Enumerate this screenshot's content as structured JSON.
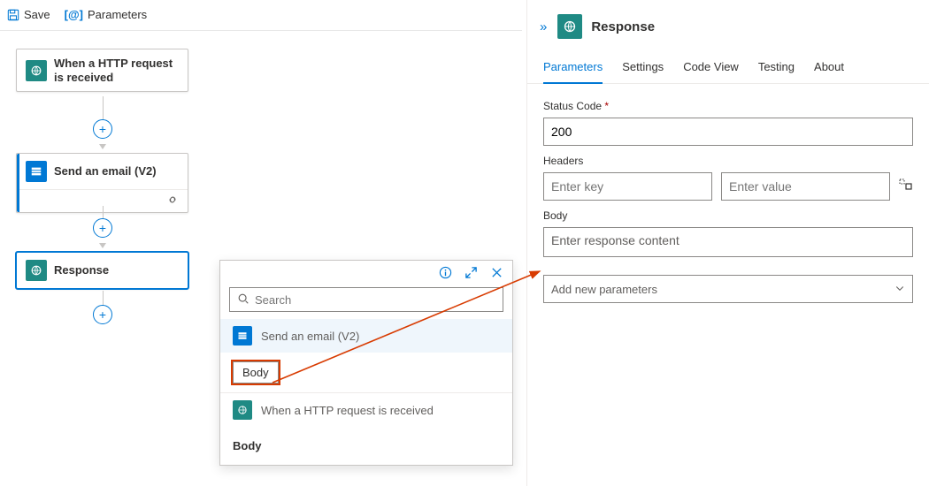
{
  "toolbar": {
    "save": "Save",
    "parameters": "Parameters"
  },
  "flow": {
    "nodes": {
      "trigger": {
        "title": "When a HTTP request is received"
      },
      "email": {
        "title": "Send an email (V2)"
      },
      "response": {
        "title": "Response"
      }
    }
  },
  "popup": {
    "search_placeholder": "Search",
    "categories": {
      "email": "Send an email (V2)",
      "trigger": "When a HTTP request is received"
    },
    "tokens": {
      "body1": "Body",
      "body2": "Body"
    }
  },
  "panel": {
    "title": "Response",
    "tabs": {
      "parameters": "Parameters",
      "settings": "Settings",
      "code_view": "Code View",
      "testing": "Testing",
      "about": "About"
    },
    "fields": {
      "status_label": "Status Code",
      "status_value": "200",
      "headers_label": "Headers",
      "header_key_placeholder": "Enter key",
      "header_value_placeholder": "Enter value",
      "body_label": "Body",
      "body_placeholder": "Enter response content",
      "add_params": "Add new parameters"
    }
  }
}
